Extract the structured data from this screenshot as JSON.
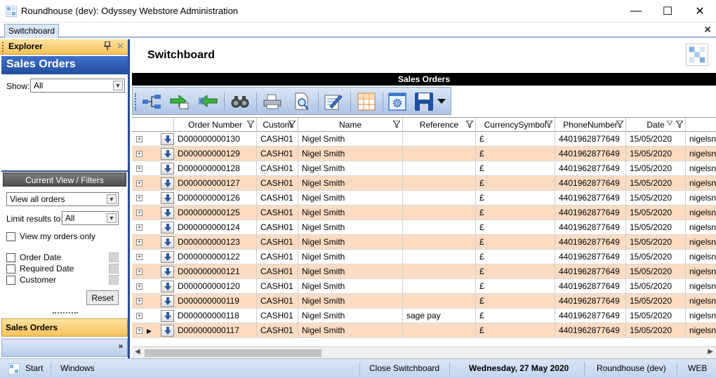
{
  "window": {
    "title": "Roundhouse (dev): Odyssey Webstore Administration",
    "minimize_glyph": "—",
    "maximize_glyph": "☐",
    "close_glyph": "✕"
  },
  "tabs": {
    "active": "Switchboard",
    "close_glyph": "✕"
  },
  "explorer": {
    "title": "Explorer",
    "section_title": "Sales Orders",
    "show_label": "Show:",
    "show_value": "All",
    "current_view_title": "Current View / Filters",
    "view_value": "View all orders",
    "limit_label": "Limit results to:",
    "limit_value": "All",
    "view_my_orders_label": "View my orders only",
    "filters": [
      "Order Date",
      "Required Date",
      "Customer"
    ],
    "reset_label": "Reset",
    "bottom_section": "Sales Orders",
    "more_glyph": "»"
  },
  "main": {
    "title": "Switchboard",
    "section_header": "Sales Orders",
    "toolbar_icons": [
      "hierarchy-icon",
      "export-icon",
      "import-icon",
      "binoculars-icon",
      "print-icon",
      "print-preview-icon",
      "edit-columns-icon",
      "grid-layout-icon",
      "settings-icon",
      "save-icon"
    ]
  },
  "grid": {
    "columns": [
      "Order Number",
      "Custom",
      "Name",
      "Reference",
      "CurrencySymbol",
      "PhoneNumber",
      "Date",
      ""
    ],
    "rows": [
      {
        "order": "D000000000130",
        "cust": "CASH01",
        "name": "Nigel Smith",
        "ref": "",
        "cur": "£",
        "phone": "4401962877649",
        "date": "15/05/2020",
        "extra": "nigelsn"
      },
      {
        "order": "D000000000129",
        "cust": "CASH01",
        "name": "Nigel Smith",
        "ref": "",
        "cur": "£",
        "phone": "4401962877649",
        "date": "15/05/2020",
        "extra": "nigelsn"
      },
      {
        "order": "D000000000128",
        "cust": "CASH01",
        "name": "Nigel Smith",
        "ref": "",
        "cur": "£",
        "phone": "4401962877649",
        "date": "15/05/2020",
        "extra": "nigelsn"
      },
      {
        "order": "D000000000127",
        "cust": "CASH01",
        "name": "Nigel Smith",
        "ref": "",
        "cur": "£",
        "phone": "4401962877649",
        "date": "15/05/2020",
        "extra": "nigelsn"
      },
      {
        "order": "D000000000126",
        "cust": "CASH01",
        "name": "Nigel Smith",
        "ref": "",
        "cur": "£",
        "phone": "4401962877649",
        "date": "15/05/2020",
        "extra": "nigelsn"
      },
      {
        "order": "D000000000125",
        "cust": "CASH01",
        "name": "Nigel Smith",
        "ref": "",
        "cur": "£",
        "phone": "4401962877649",
        "date": "15/05/2020",
        "extra": "nigelsn"
      },
      {
        "order": "D000000000124",
        "cust": "CASH01",
        "name": "Nigel Smith",
        "ref": "",
        "cur": "£",
        "phone": "4401962877649",
        "date": "15/05/2020",
        "extra": "nigelsn"
      },
      {
        "order": "D000000000123",
        "cust": "CASH01",
        "name": "Nigel Smith",
        "ref": "",
        "cur": "£",
        "phone": "4401962877649",
        "date": "15/05/2020",
        "extra": "nigelsn"
      },
      {
        "order": "D000000000122",
        "cust": "CASH01",
        "name": "Nigel Smith",
        "ref": "",
        "cur": "£",
        "phone": "4401962877649",
        "date": "15/05/2020",
        "extra": "nigelsn"
      },
      {
        "order": "D000000000121",
        "cust": "CASH01",
        "name": "Nigel Smith",
        "ref": "",
        "cur": "£",
        "phone": "4401962877649",
        "date": "15/05/2020",
        "extra": "nigelsn"
      },
      {
        "order": "D000000000120",
        "cust": "CASH01",
        "name": "Nigel Smith",
        "ref": "",
        "cur": "£",
        "phone": "4401962877649",
        "date": "15/05/2020",
        "extra": "nigelsn"
      },
      {
        "order": "D000000000119",
        "cust": "CASH01",
        "name": "Nigel Smith",
        "ref": "",
        "cur": "£",
        "phone": "4401962877649",
        "date": "15/05/2020",
        "extra": "nigelsn"
      },
      {
        "order": "D000000000118",
        "cust": "CASH01",
        "name": "Nigel Smith",
        "ref": "sage pay",
        "cur": "£",
        "phone": "4401962877649",
        "date": "15/05/2020",
        "extra": "nigelsn"
      },
      {
        "order": "D000000000117",
        "cust": "CASH01",
        "name": "Nigel Smith",
        "ref": "",
        "cur": "£",
        "phone": "4401962877649",
        "date": "15/05/2020",
        "extra": "nigelsn"
      }
    ],
    "current_row_index": 13
  },
  "statusbar": {
    "start": "Start",
    "windows": "Windows",
    "close_switchboard": "Close Switchboard",
    "date": "Wednesday, 27 May 2020",
    "env": "Roundhouse (dev)",
    "mode": "WEB"
  },
  "colors": {
    "accent_blue": "#2a4e9a",
    "row_alt": "#fbdcc2",
    "header_orange": "#f6c25a"
  }
}
